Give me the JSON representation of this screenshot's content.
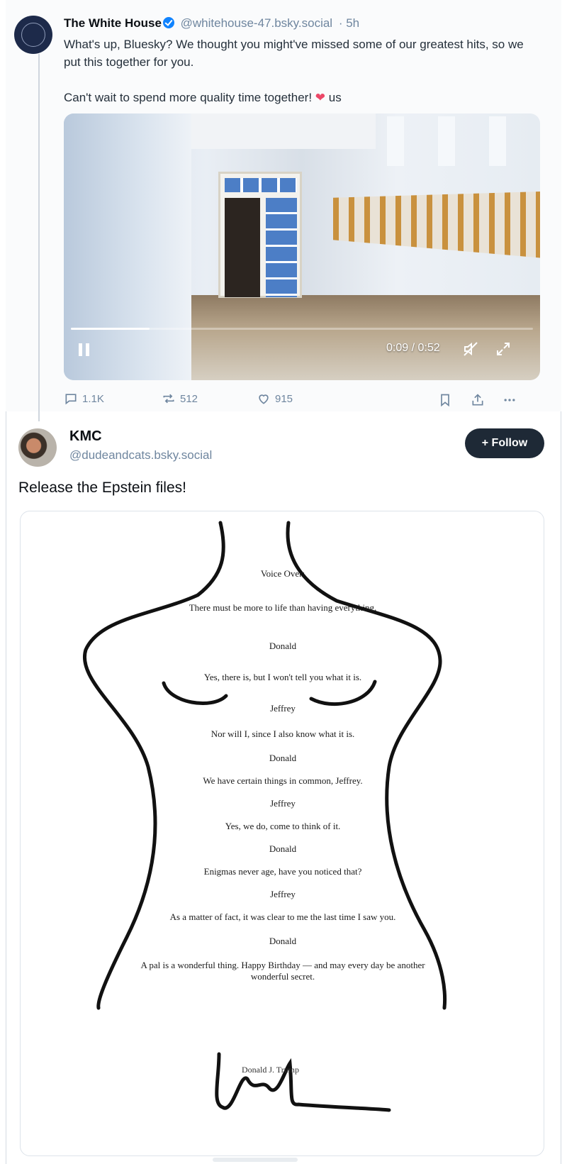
{
  "parent_post": {
    "display_name": "The White House",
    "handle": "@whitehouse-47.bsky.social",
    "time": "· 5h",
    "text_line1": "What's up, Bluesky? We thought you might've missed some of our greatest hits, so we put this together for you.",
    "text_line2_before": "Can't wait to spend more quality time together! ",
    "heart": "❤",
    "text_line2_after": " us",
    "video": {
      "time_display": "0:09 / 0:52",
      "progress": 0.17
    },
    "actions": {
      "replies": "1.1K",
      "reposts": "512",
      "likes": "915"
    }
  },
  "post": {
    "display_name": "KMC",
    "handle": "@dudeandcats.bsky.social",
    "follow_label": "+ Follow",
    "text": "Release the Epstein files!"
  },
  "letter": {
    "lines": [
      "Voice Over:",
      "There must be more to life than having everything.",
      "Donald",
      "Yes, there is, but I won't tell you what it is.",
      "Jeffrey",
      "Nor will I, since I also know what it is.",
      "Donald",
      "We have certain things in common, Jeffrey.",
      "Jeffrey",
      "Yes, we do, come to think of it.",
      "Donald",
      "Enigmas never age, have you noticed that?",
      "Jeffrey",
      "As a matter of fact, it was clear to me the last time I saw you.",
      "Donald",
      "A pal is a wonderful thing. Happy Birthday — and may every day be another",
      "wonderful secret."
    ],
    "signature_name": "Donald J. Trump"
  },
  "colors": {
    "accent_blue": "#1083fe",
    "muted_text": "#6f869f",
    "follow_bg": "#1e2936",
    "heart": "#ec4868"
  }
}
